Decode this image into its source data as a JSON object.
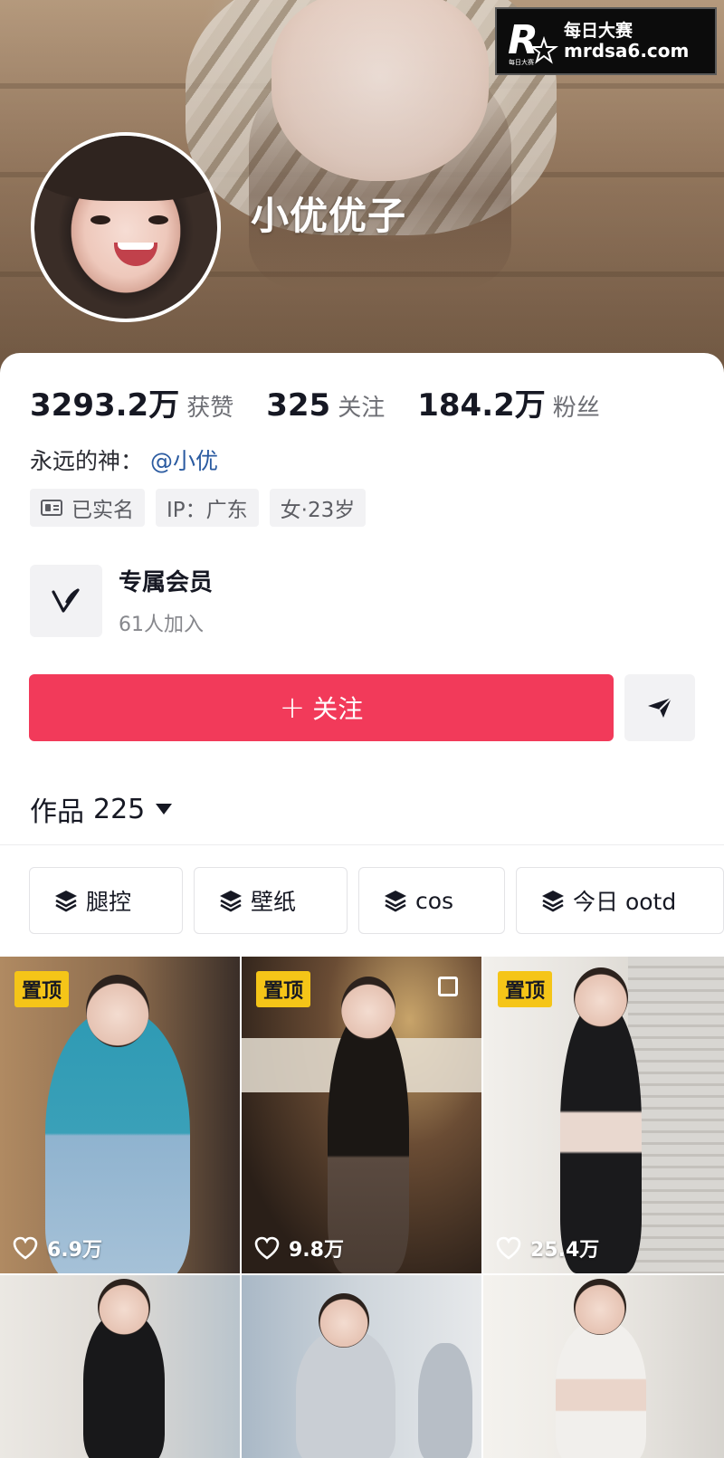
{
  "watermark": {
    "line1": "每日大赛",
    "line2": "mrdsa6.com",
    "logo_letter": "R",
    "logo_sub": "每日大赛"
  },
  "profile": {
    "nickname": "小优优子"
  },
  "stats": [
    {
      "value": "3293.2万",
      "label": "获赞"
    },
    {
      "value": "325",
      "label": "关注"
    },
    {
      "value": "184.2万",
      "label": "粉丝"
    }
  ],
  "bio": {
    "text": "永远的神：",
    "mention": "@小优"
  },
  "tags": [
    {
      "label": "已实名",
      "icon": "id-card-icon"
    },
    {
      "label": "IP：广东"
    },
    {
      "label": "女·23岁"
    }
  ],
  "member": {
    "title": "专属会员",
    "subtitle": "61人加入",
    "icon": "v-logo-icon"
  },
  "actions": {
    "follow_plus": "+",
    "follow_label": "关注",
    "send_icon": "send-icon"
  },
  "works": {
    "label": "作品",
    "count": "225"
  },
  "collections": [
    {
      "label": "腿控",
      "icon": "layers-icon"
    },
    {
      "label": "壁纸",
      "icon": "layers-icon"
    },
    {
      "label": "cos",
      "icon": "layers-icon"
    },
    {
      "label": "今日 ootd",
      "icon": "layers-icon"
    }
  ],
  "videos": [
    {
      "pinned": true,
      "pin_label": "置顶",
      "likes": "6.9万",
      "bg": "#8a6a4c",
      "outfit": "#3aa0b8"
    },
    {
      "pinned": true,
      "pin_label": "置顶",
      "likes": "9.8万",
      "bg": "#4a3526",
      "outfit": "#1b1714"
    },
    {
      "pinned": true,
      "pin_label": "置顶",
      "likes": "25.4万",
      "bg": "#e7e4df",
      "outfit": "#1a1a1c"
    },
    {
      "pinned": false,
      "bg": "#dedad5",
      "outfit": "#18181a"
    },
    {
      "pinned": false,
      "bg": "#cfd6dc",
      "outfit": "#c9ced4"
    },
    {
      "pinned": false,
      "bg": "#ece9e4",
      "outfit": "#f1efec"
    }
  ],
  "colors": {
    "accent": "#f23a5a",
    "pin": "#f5c518",
    "mention": "#2a5aa0"
  }
}
